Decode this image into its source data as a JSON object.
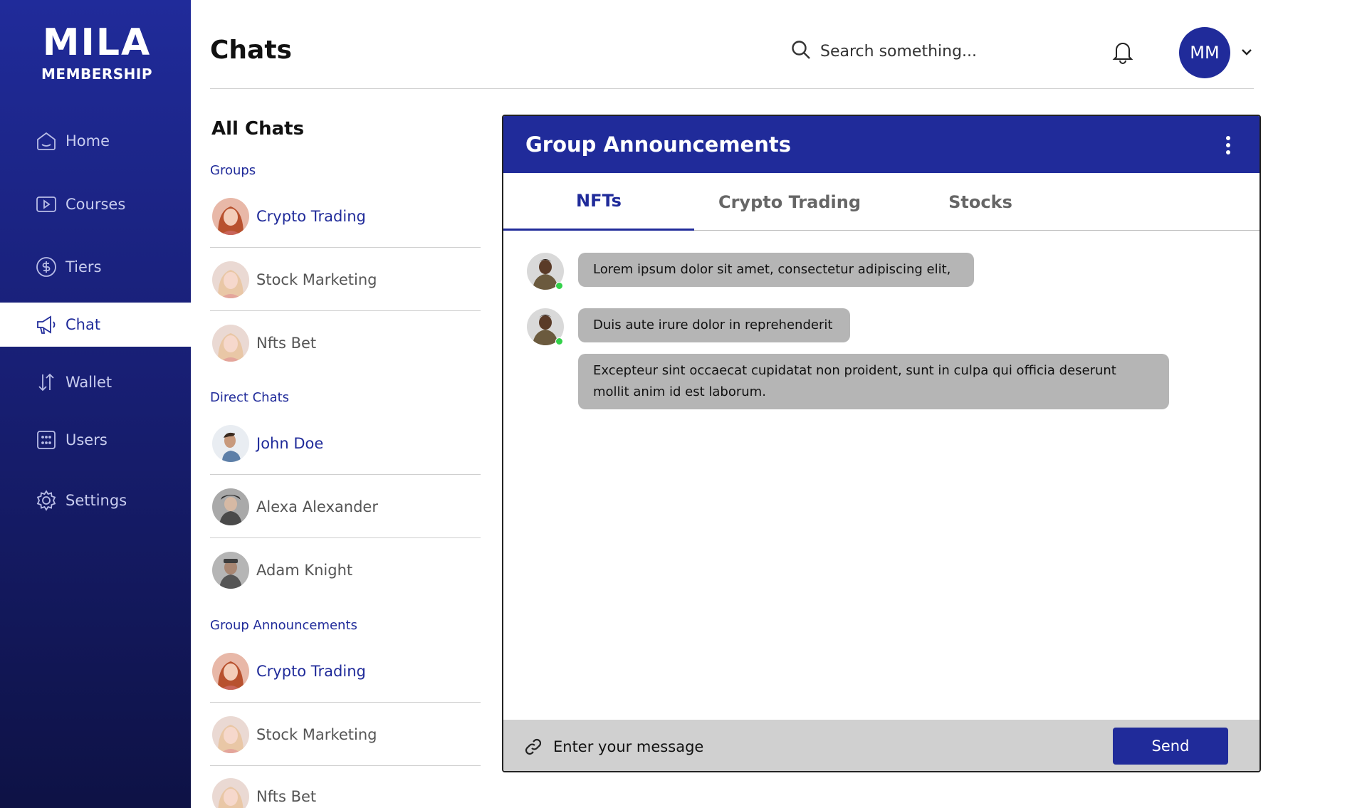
{
  "brand": {
    "logo_top": "MILA",
    "logo_bottom": "MEMBERSHIP"
  },
  "sidebar": {
    "items": [
      {
        "label": "Home",
        "icon": "home-icon"
      },
      {
        "label": "Courses",
        "icon": "play-icon"
      },
      {
        "label": "Tiers",
        "icon": "dollar-icon"
      },
      {
        "label": "Chat",
        "icon": "megaphone-icon",
        "active": true
      },
      {
        "label": "Wallet",
        "icon": "transfer-icon"
      },
      {
        "label": "Users",
        "icon": "users-grid-icon"
      },
      {
        "label": "Settings",
        "icon": "gear-icon"
      }
    ]
  },
  "header": {
    "title": "Chats",
    "search_placeholder": "Search something...",
    "avatar_initials": "MM"
  },
  "chat_list": {
    "heading": "All Chats",
    "groups_label": "Groups",
    "groups": [
      {
        "name": "Crypto Trading",
        "highlight": true
      },
      {
        "name": "Stock Marketing",
        "highlight": false
      },
      {
        "name": "Nfts Bet",
        "highlight": false
      }
    ],
    "direct_label": "Direct Chats",
    "direct": [
      {
        "name": "John Doe",
        "highlight": true
      },
      {
        "name": "Alexa Alexander",
        "highlight": false
      },
      {
        "name": "Adam Knight",
        "highlight": false
      }
    ],
    "announcements_label": "Group Announcements",
    "announcements": [
      {
        "name": "Crypto Trading",
        "highlight": true
      },
      {
        "name": "Stock Marketing",
        "highlight": false
      },
      {
        "name": "Nfts Bet",
        "highlight": false
      }
    ]
  },
  "panel": {
    "title": "Group Announcements",
    "tabs": [
      {
        "label": "NFTs",
        "active": true
      },
      {
        "label": "Crypto Trading",
        "active": false
      },
      {
        "label": "Stocks",
        "active": false
      }
    ],
    "messages": [
      "Lorem ipsum dolor sit amet, consectetur adipiscing elit,",
      "Duis aute irure dolor in reprehenderit",
      "Excepteur sint occaecat cupidatat non proident, sunt in culpa qui officia deserunt mollit anim id est laborum."
    ],
    "composer_placeholder": "Enter your message",
    "send_label": "Send"
  },
  "colors": {
    "primary": "#202b9a",
    "bubble": "#b5b5b5",
    "online": "#33d14a"
  }
}
